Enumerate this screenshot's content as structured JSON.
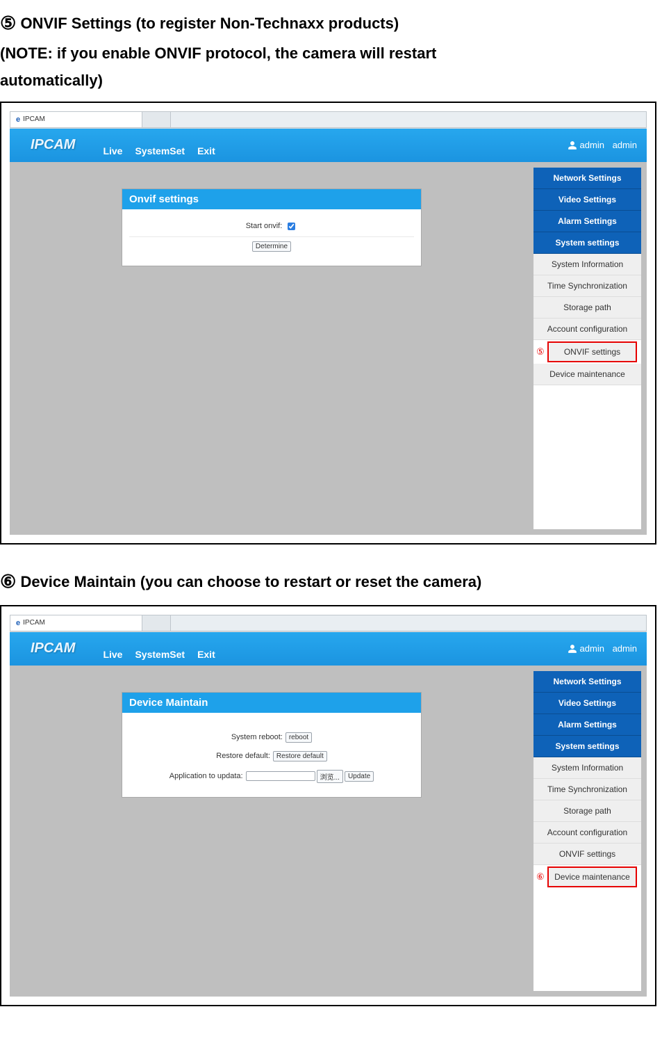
{
  "doc": {
    "heading1_marker": "⑤",
    "heading1_line1": "ONVIF Settings (to register Non-Technaxx products)",
    "heading1_line2": "(NOTE: if you enable ONVIF protocol, the camera will restart",
    "heading1_line3": "automatically)",
    "heading2_marker": "⑥",
    "heading2_line1": "Device Maintain (you can choose to restart or reset the camera)"
  },
  "shot1": {
    "tab_title": "IPCAM",
    "logo": "IPCAM",
    "nav": {
      "live": "Live",
      "systemset": "SystemSet",
      "exit": "Exit"
    },
    "user": {
      "role": "admin",
      "name": "admin"
    },
    "panel_title": "Onvif settings",
    "form": {
      "start_label": "Start onvif:",
      "determine_btn": "Determine"
    },
    "sidebar": {
      "groups": {
        "network": "Network Settings",
        "video": "Video Settings",
        "alarm": "Alarm Settings",
        "system": "System settings"
      },
      "items": {
        "sysinfo": "System Information",
        "timesync": "Time Synchronization",
        "storage": "Storage path",
        "account": "Account configuration",
        "onvif": "ONVIF settings",
        "maint": "Device maintenance"
      },
      "marker": "⑤"
    }
  },
  "shot2": {
    "tab_title": "IPCAM",
    "logo": "IPCAM",
    "nav": {
      "live": "Live",
      "systemset": "SystemSet",
      "exit": "Exit"
    },
    "user": {
      "role": "admin",
      "name": "admin"
    },
    "panel_title": "Device Maintain",
    "form": {
      "reboot_label": "System reboot:",
      "reboot_btn": "reboot",
      "restore_label": "Restore default:",
      "restore_btn": "Restore default",
      "update_label": "Application to updata:",
      "browse_btn": "浏览...",
      "update_btn": "Update"
    },
    "sidebar": {
      "groups": {
        "network": "Network Settings",
        "video": "Video Settings",
        "alarm": "Alarm Settings",
        "system": "System settings"
      },
      "items": {
        "sysinfo": "System Information",
        "timesync": "Time Synchronization",
        "storage": "Storage path",
        "account": "Account configuration",
        "onvif": "ONVIF settings",
        "maint": "Device maintenance"
      },
      "marker": "⑥"
    }
  }
}
